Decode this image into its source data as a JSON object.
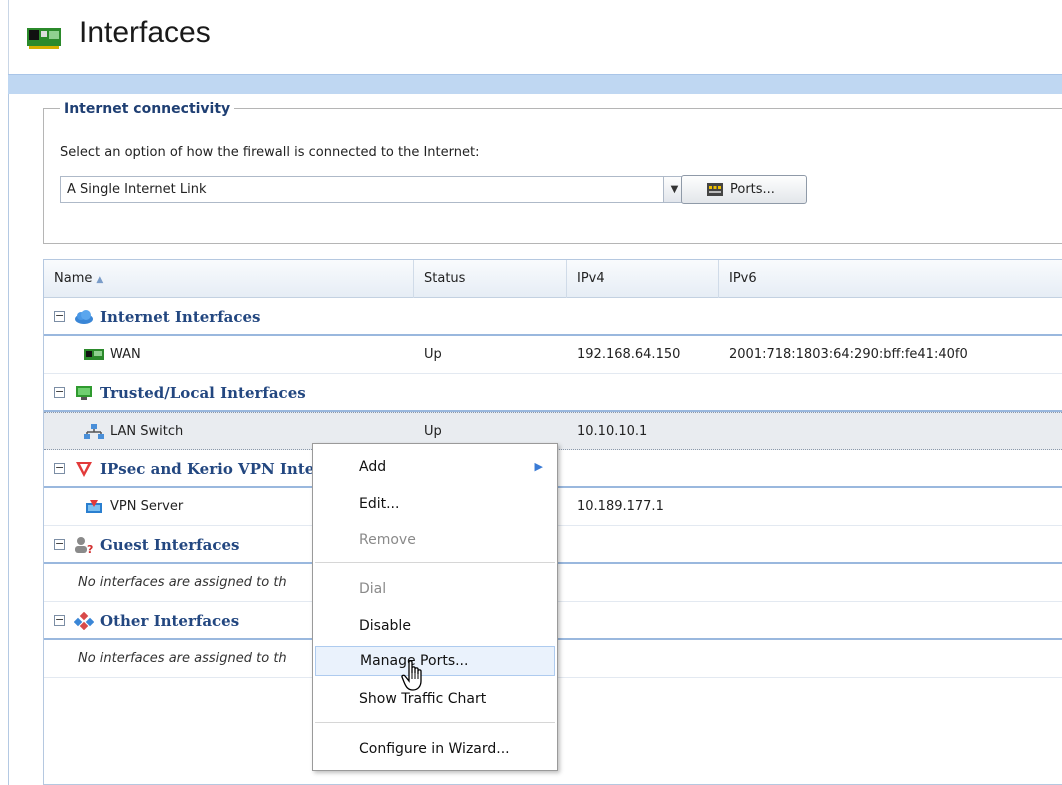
{
  "window": {
    "title": "Interfaces",
    "icon": "network-card-icon"
  },
  "connectivity": {
    "legend": "Internet connectivity",
    "description": "Select an option of how the firewall is connected to the Internet:",
    "selected_option": "A Single Internet Link",
    "ports_button": "Ports..."
  },
  "grid": {
    "columns": [
      {
        "label": "Name",
        "sort": "ascending"
      },
      {
        "label": "Status"
      },
      {
        "label": "IPv4"
      },
      {
        "label": "IPv6"
      }
    ],
    "groups": [
      {
        "title": "Internet Interfaces",
        "icon": "cloud-icon",
        "rows": [
          {
            "name": "WAN",
            "status": "Up",
            "ipv4": "192.168.64.150",
            "ipv6": "2001:718:1803:64:290:bff:fe41:40f0",
            "icon": "network-card-icon"
          }
        ]
      },
      {
        "title": "Trusted/Local Interfaces",
        "icon": "monitor-icon",
        "rows": [
          {
            "name": "LAN Switch",
            "status": "Up",
            "ipv4": "10.10.10.1",
            "ipv6": "",
            "icon": "switch-icon",
            "selected": true
          }
        ]
      },
      {
        "title": "IPsec and Kerio VPN Inte",
        "icon": "shield-icon",
        "rows": [
          {
            "name": "VPN Server",
            "status": "",
            "ipv4": "10.189.177.1",
            "ipv6": "",
            "icon": "vpn-server-icon"
          }
        ]
      },
      {
        "title": "Guest Interfaces",
        "icon": "guest-users-icon",
        "empty_text": "No interfaces are assigned to th"
      },
      {
        "title": "Other Interfaces",
        "icon": "diamond-network-icon",
        "empty_text": "No interfaces are assigned to th"
      }
    ]
  },
  "context_menu": {
    "items": [
      {
        "label": "Add",
        "submenu": true
      },
      {
        "label": "Edit..."
      },
      {
        "label": "Remove",
        "disabled": true
      },
      {
        "label": "Dial",
        "disabled": true
      },
      {
        "label": "Disable"
      },
      {
        "label": "Manage Ports...",
        "hover": true
      },
      {
        "label": "Show Traffic Chart"
      },
      {
        "label": "Configure in Wizard..."
      }
    ]
  },
  "colors": {
    "group_title": "#234780",
    "accent_band": "#bfd7f2",
    "menu_hover": "#eaf2fc"
  }
}
